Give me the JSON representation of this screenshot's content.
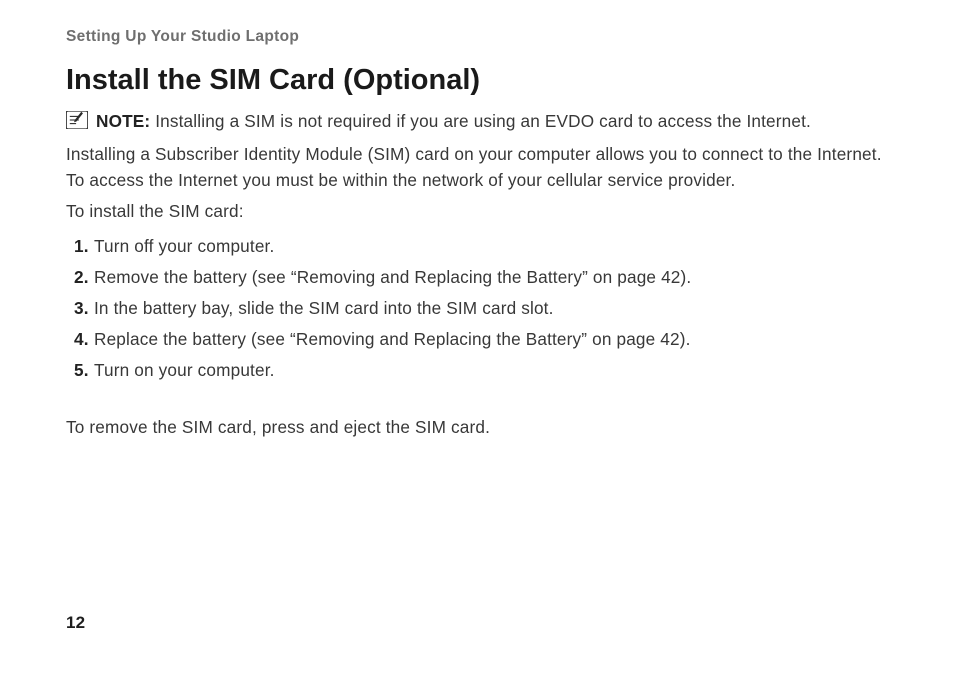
{
  "chapter": "Setting Up Your Studio Laptop",
  "section_title": "Install the SIM Card (Optional)",
  "note": {
    "label": "NOTE:",
    "text": " Installing a SIM is not required if you are using an EVDO card to access the Internet."
  },
  "intro": "Installing a Subscriber Identity Module (SIM) card on your computer allows you to connect to the Internet. To access the Internet you must be within the network of your cellular service provider.",
  "lead_in": "To install the SIM card:",
  "steps": [
    {
      "n": "1.",
      "text": "Turn off your computer."
    },
    {
      "n": "2.",
      "text": "Remove the battery (see “Removing and Replacing the Battery” on page 42)."
    },
    {
      "n": "3.",
      "text": "In the battery bay, slide the SIM card into the SIM card slot."
    },
    {
      "n": "4.",
      "text": "Replace the battery (see “Removing and Replacing the Battery” on page 42)."
    },
    {
      "n": "5.",
      "text": "Turn on your computer."
    }
  ],
  "closing": "To remove the SIM card, press and eject the SIM card.",
  "page_number": "12"
}
